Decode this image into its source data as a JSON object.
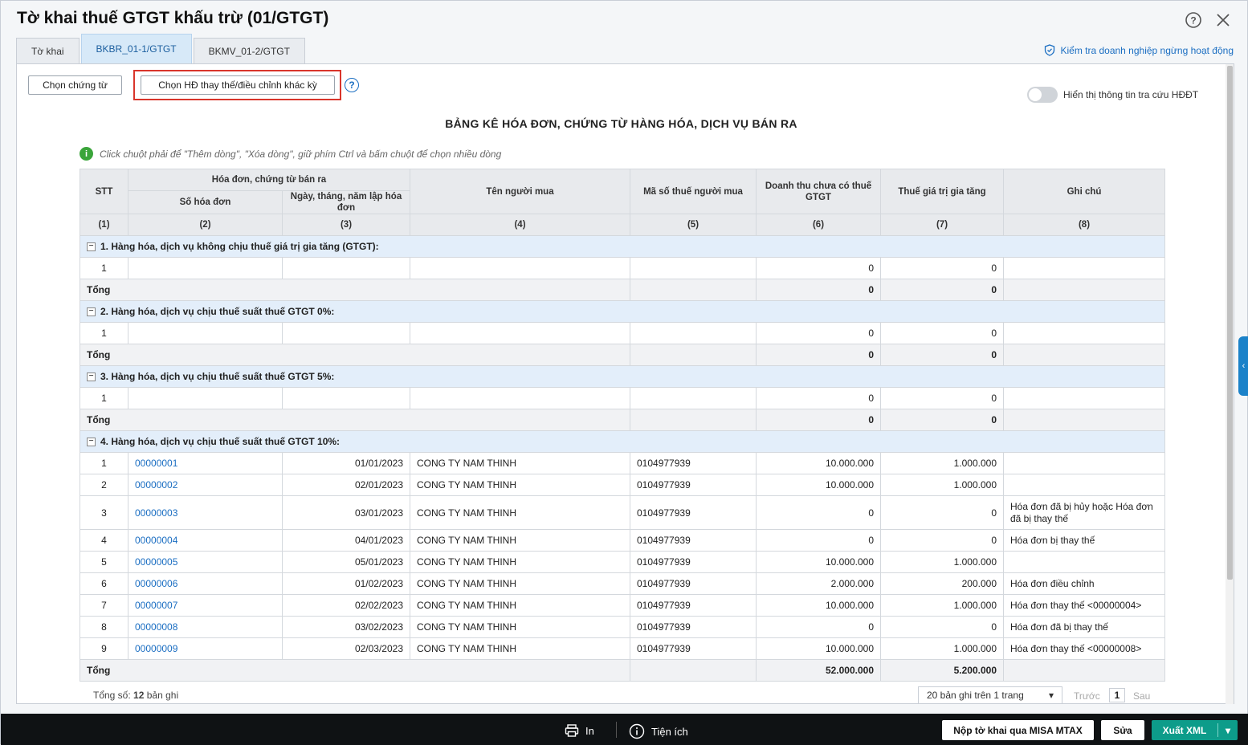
{
  "header": {
    "title": "Tờ khai thuế GTGT khấu trừ (01/GTGT)"
  },
  "tabs": [
    {
      "label": "Tờ khai"
    },
    {
      "label": "BKBR_01-1/GTGT"
    },
    {
      "label": "BKMV_01-2/GTGT"
    }
  ],
  "check_link": "Kiểm tra doanh nghiệp ngừng hoạt động",
  "toolbar": {
    "choose_doc": "Chọn chứng từ",
    "choose_replace": "Chọn HĐ thay thế/điều chỉnh khác kỳ",
    "help": "?"
  },
  "toggle_label": "Hiển thị thông tin tra cứu HĐĐT",
  "sheet_title": "BẢNG KÊ HÓA ĐƠN, CHỨNG TỪ HÀNG HÓA, DỊCH VỤ BÁN RA",
  "hint": "Click chuột phải để \"Thêm dòng\", \"Xóa dòng\", giữ phím Ctrl và bấm chuột để chọn nhiều dòng",
  "hint_icon": "i",
  "table": {
    "h_stt": "STT",
    "h_group": "Hóa đơn, chứng từ bán ra",
    "h_so": "Số hóa đơn",
    "h_ngay": "Ngày, tháng, năm lập hóa đơn",
    "h_ten": "Tên người mua",
    "h_mst": "Mã số thuế người mua",
    "h_dt": "Doanh thu chưa có thuế GTGT",
    "h_thue": "Thuế giá trị gia tăng",
    "h_ghichu": "Ghi chú",
    "idx": [
      "(1)",
      "(2)",
      "(3)",
      "(4)",
      "(5)",
      "(6)",
      "(7)",
      "(8)"
    ],
    "total_label": "Tổng",
    "g1": "1. Hàng hóa, dịch vụ không chịu thuế giá trị gia tăng (GTGT):",
    "g2": "2. Hàng hóa, dịch vụ chịu thuế suất thuế GTGT 0%:",
    "g3": "3. Hàng hóa, dịch vụ chịu thuế suất thuế GTGT 5%:",
    "g4": "4. Hàng hóa, dịch vụ chịu thuế suất thuế GTGT 10%:",
    "empty_row": {
      "stt": "1",
      "dt": "0",
      "thue": "0"
    },
    "empty_total": {
      "dt": "0",
      "thue": "0"
    },
    "rows": [
      {
        "stt": "1",
        "so": "00000001",
        "ngay": "01/01/2023",
        "ten": "CONG TY NAM THINH",
        "mst": "0104977939",
        "dt": "10.000.000",
        "thue": "1.000.000",
        "ghichu": ""
      },
      {
        "stt": "2",
        "so": "00000002",
        "ngay": "02/01/2023",
        "ten": "CONG TY NAM THINH",
        "mst": "0104977939",
        "dt": "10.000.000",
        "thue": "1.000.000",
        "ghichu": ""
      },
      {
        "stt": "3",
        "so": "00000003",
        "ngay": "03/01/2023",
        "ten": "CONG TY NAM THINH",
        "mst": "0104977939",
        "dt": "0",
        "thue": "0",
        "ghichu": "Hóa đơn đã bị hủy hoặc Hóa đơn đã bị thay thế"
      },
      {
        "stt": "4",
        "so": "00000004",
        "ngay": "04/01/2023",
        "ten": "CONG TY NAM THINH",
        "mst": "0104977939",
        "dt": "0",
        "thue": "0",
        "ghichu": "Hóa đơn bị thay thế"
      },
      {
        "stt": "5",
        "so": "00000005",
        "ngay": "05/01/2023",
        "ten": "CONG TY NAM THINH",
        "mst": "0104977939",
        "dt": "10.000.000",
        "thue": "1.000.000",
        "ghichu": ""
      },
      {
        "stt": "6",
        "so": "00000006",
        "ngay": "01/02/2023",
        "ten": "CONG TY NAM THINH",
        "mst": "0104977939",
        "dt": "2.000.000",
        "thue": "200.000",
        "ghichu": "Hóa đơn điều chỉnh"
      },
      {
        "stt": "7",
        "so": "00000007",
        "ngay": "02/02/2023",
        "ten": "CONG TY NAM THINH",
        "mst": "0104977939",
        "dt": "10.000.000",
        "thue": "1.000.000",
        "ghichu": "Hóa đơn thay thế <00000004>"
      },
      {
        "stt": "8",
        "so": "00000008",
        "ngay": "03/02/2023",
        "ten": "CONG TY NAM THINH",
        "mst": "0104977939",
        "dt": "0",
        "thue": "0",
        "ghichu": "Hóa đơn đã bị thay thế"
      },
      {
        "stt": "9",
        "so": "00000009",
        "ngay": "02/03/2023",
        "ten": "CONG TY NAM THINH",
        "mst": "0104977939",
        "dt": "10.000.000",
        "thue": "1.000.000",
        "ghichu": "Hóa đơn thay thế <00000008>"
      }
    ],
    "g4_total": {
      "dt": "52.000.000",
      "thue": "5.200.000"
    }
  },
  "footer": {
    "total_prefix": "Tổng số:",
    "total_count": "12",
    "total_suffix": "bản ghi",
    "page_size": "20 bản ghi trên 1 trang",
    "prev": "Trước",
    "page": "1",
    "next": "Sau"
  },
  "bottom": {
    "print": "In",
    "utility": "Tiện ích",
    "submit": "Nộp tờ khai qua MISA MTAX",
    "edit": "Sửa",
    "export": "Xuất XML"
  },
  "colors": {
    "accent": "#1b6ec2",
    "highlight": "#d9352b",
    "export": "#0d9c8a"
  }
}
